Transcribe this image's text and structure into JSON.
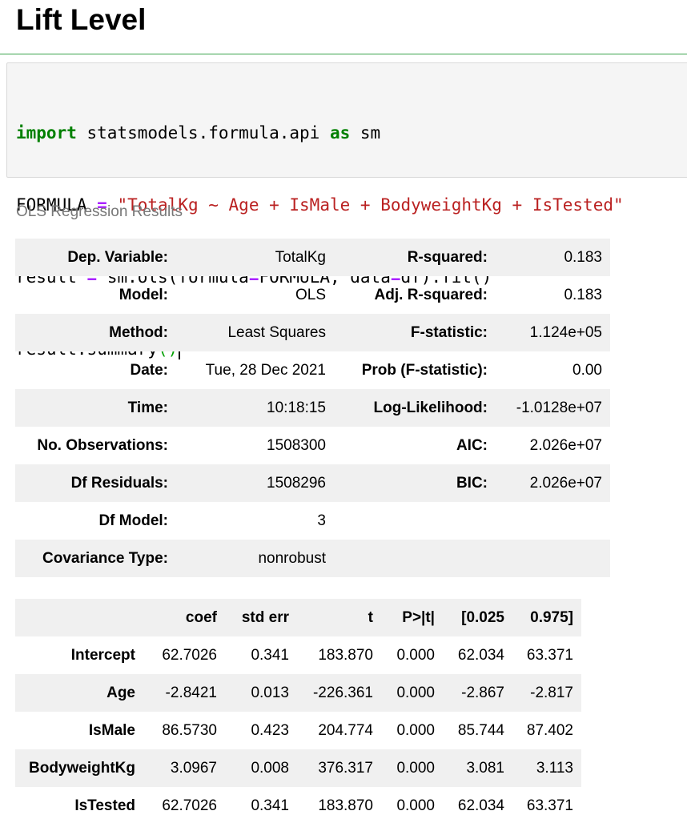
{
  "heading": "Lift Level",
  "code": {
    "line1": {
      "kw1": "import",
      "mod": " statsmodels.formula.api ",
      "kw2": "as",
      "alias": " sm"
    },
    "line2": {
      "name": "FORMULA ",
      "op": "=",
      "sp": " ",
      "str": "\"TotalKg ~ Age + IsMale + BodyweightKg + IsTested\""
    },
    "line3": {
      "a": "result ",
      "op1": "=",
      "b": " sm.ols(formula",
      "op2": "=",
      "c": "FORMULA, data",
      "op3": "=",
      "d": "df).fit()"
    },
    "line4": {
      "a": "result.summary",
      "paren": "()"
    }
  },
  "caption": "OLS Regression Results",
  "summary_rows": [
    [
      "Dep. Variable:",
      "TotalKg",
      "R-squared:",
      "0.183"
    ],
    [
      "Model:",
      "OLS",
      "Adj. R-squared:",
      "0.183"
    ],
    [
      "Method:",
      "Least Squares",
      "F-statistic:",
      "1.124e+05"
    ],
    [
      "Date:",
      "Tue, 28 Dec 2021",
      "Prob (F-statistic):",
      "0.00"
    ],
    [
      "Time:",
      "10:18:15",
      "Log-Likelihood:",
      "-1.0128e+07"
    ],
    [
      "No. Observations:",
      "1508300",
      "AIC:",
      "2.026e+07"
    ],
    [
      "Df Residuals:",
      "1508296",
      "BIC:",
      "2.026e+07"
    ],
    [
      "Df Model:",
      "3",
      "",
      ""
    ],
    [
      "Covariance Type:",
      "nonrobust",
      "",
      ""
    ]
  ],
  "coef_table": {
    "headers": [
      "",
      "coef",
      "std err",
      "t",
      "P>|t|",
      "[0.025",
      "0.975]"
    ],
    "rows": [
      [
        "Intercept",
        "62.7026",
        "0.341",
        "183.870",
        "0.000",
        "62.034",
        "63.371"
      ],
      [
        "Age",
        "-2.8421",
        "0.013",
        "-226.361",
        "0.000",
        "-2.867",
        "-2.817"
      ],
      [
        "IsMale",
        "86.5730",
        "0.423",
        "204.774",
        "0.000",
        "85.744",
        "87.402"
      ],
      [
        "BodyweightKg",
        "3.0967",
        "0.008",
        "376.317",
        "0.000",
        "3.081",
        "3.113"
      ],
      [
        "IsTested",
        "62.7026",
        "0.341",
        "183.870",
        "0.000",
        "62.034",
        "63.371"
      ]
    ]
  }
}
